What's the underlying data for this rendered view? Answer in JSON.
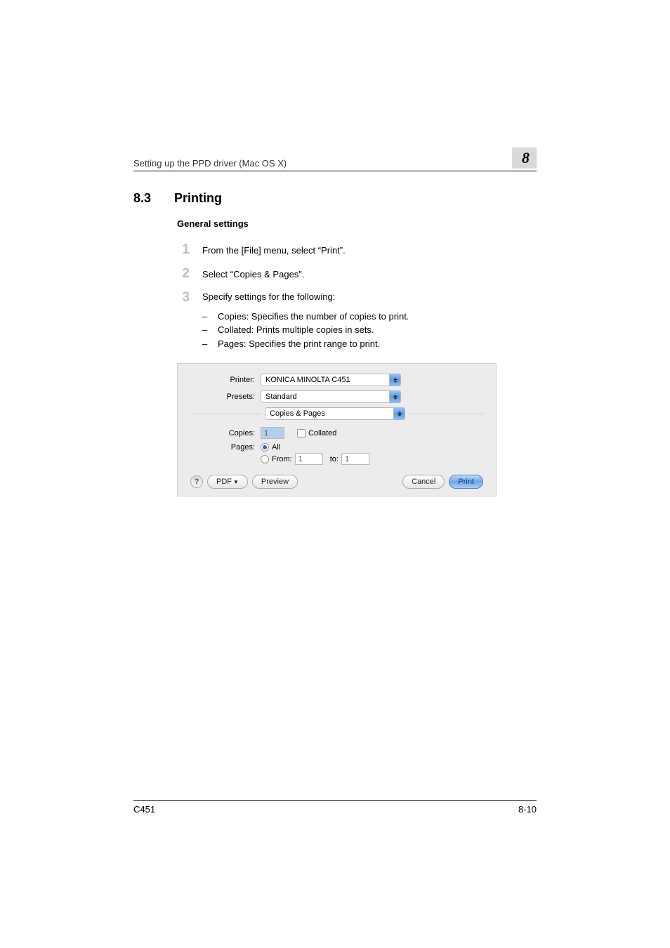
{
  "header": {
    "breadcrumb": "Setting up the PPD driver (Mac OS X)",
    "chapter": "8"
  },
  "section": {
    "number": "8.3",
    "title": "Printing"
  },
  "subheading": "General settings",
  "steps": [
    {
      "num": "1",
      "text": "From the [File] menu, select “Print”."
    },
    {
      "num": "2",
      "text": "Select “Copies & Pages”."
    },
    {
      "num": "3",
      "text": "Specify settings for the following:"
    }
  ],
  "bullets": [
    "Copies: Specifies the number of copies to print.",
    "Collated: Prints multiple copies in sets.",
    "Pages: Specifies the print range to print."
  ],
  "dialog": {
    "printer_label": "Printer:",
    "printer_value": "KONICA MINOLTA C451",
    "presets_label": "Presets:",
    "presets_value": "Standard",
    "panel_value": "Copies & Pages",
    "copies_label": "Copies:",
    "copies_value": "1",
    "collated_label": "Collated",
    "pages_label": "Pages:",
    "all_label": "All",
    "from_label": "From:",
    "from_value": "1",
    "to_label": "to:",
    "to_value": "1",
    "help_label": "?",
    "pdf_label": "PDF",
    "preview_label": "Preview",
    "cancel_label": "Cancel",
    "print_label": "Print"
  },
  "footer": {
    "model": "C451",
    "pagenum": "8-10"
  }
}
